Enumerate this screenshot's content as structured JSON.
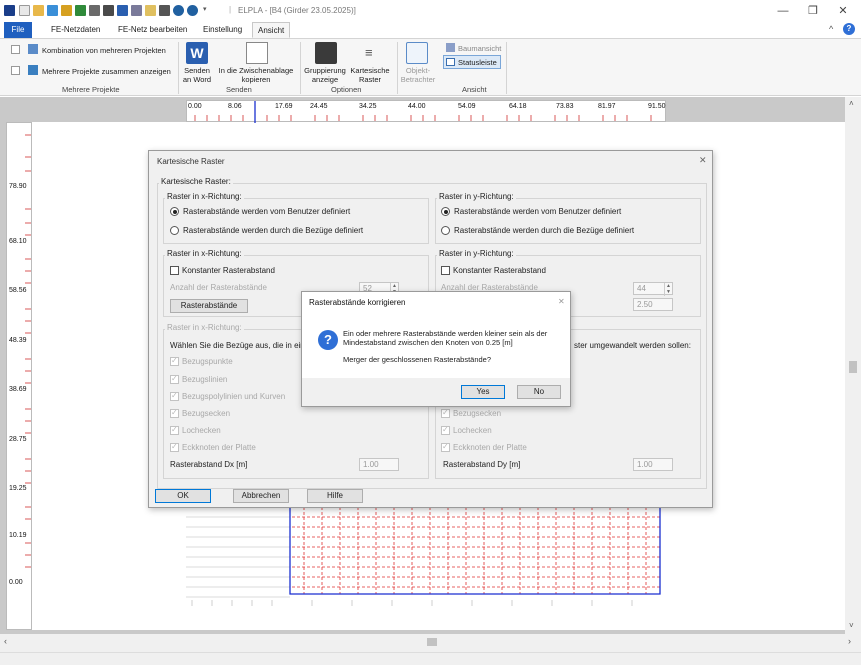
{
  "app": {
    "title": "ELPLA - [B4 (Girder 23.05.2025)]",
    "separator": "|",
    "window_controls": {
      "minimize": "—",
      "restore": "❐",
      "close": "✕"
    },
    "ribbon_collapse": "^",
    "help": "?"
  },
  "tabs": [
    {
      "label": "File"
    },
    {
      "label": "FE-Netzdaten"
    },
    {
      "label": "FE-Netz bearbeiten"
    },
    {
      "label": "Einstellung"
    },
    {
      "label": "Ansicht"
    }
  ],
  "ribbon": {
    "group_mehrere": {
      "label": "Mehrere Projekte",
      "item1": "Kombination von mehreren Projekten",
      "item2": "Mehrere Projekte zusammen anzeigen"
    },
    "group_senden": {
      "label": "Senden",
      "btn_word_l1": "Senden",
      "btn_word_l2": "an Word",
      "btn_clip_l1": "In die Zwischenablage",
      "btn_clip_l2": "kopieren"
    },
    "group_optionen": {
      "label": "Optionen",
      "btn_grup_l1": "Gruppierung",
      "btn_grup_l2": "anzeige",
      "btn_kart_l1": "Kartesische",
      "btn_kart_l2": "Raster"
    },
    "group_ansicht": {
      "label": "Ansicht",
      "btn_obj_l1": "Objekt-",
      "btn_obj_l2": "Betrachter",
      "baumansicht": "Baumansicht",
      "statusleiste": "Statusleiste"
    }
  },
  "rulers": {
    "x_labels": [
      "0.00",
      "8.06",
      "17.69",
      "24.45",
      "34.25",
      "44.00",
      "54.09",
      "64.18",
      "73.83",
      "81.97",
      "91.50"
    ],
    "y_labels": [
      "78.90",
      "68.10",
      "58.56",
      "48.39",
      "38.69",
      "28.75",
      "19.25",
      "10.19",
      "0.00"
    ]
  },
  "dialog_raster": {
    "title": "Kartesische Raster",
    "close": "✕",
    "outer_group": "Kartesische Raster:",
    "x_dir_title": "Raster in x-Richtung:",
    "y_dir_title": "Raster in y-Richtung:",
    "radio_user": "Rasterabstände werden vom Benutzer definiert",
    "radio_bezug": "Rasterabstände werden durch die Bezüge definiert",
    "x2_title": "Raster in x-Richtung:",
    "y2_title": "Raster in y-Richtung:",
    "konstant": "Konstanter Rasterabstand",
    "anzahl_label": "Anzahl der Rasterabstände",
    "anzahl_x": "52",
    "anzahl_y": "44",
    "y_value": "2.50",
    "btn_rasterabstaende": "Rasterabstände",
    "x3_title": "Raster in x-Richtung:",
    "waehlen_text": "Wählen Sie die Bezüge aus, die in ein Ra",
    "umgewandelt_text": "ster umgewandelt werden sollen:",
    "cb_bezugspunkte": "Bezugspunkte",
    "cb_bezugslinien": "Bezugslinien",
    "cb_polylinien": "Bezugspolylinien und Kurven",
    "cb_bezugsecken": "Bezugsecken",
    "cb_lochecken": "Lochecken",
    "cb_eckknoten": "Eckknoten der Platte",
    "dx_label": "Rasterabstand Dx [m]",
    "dy_label": "Rasterabstand Dy [m]",
    "dx_value": "1.00",
    "dy_value": "1.00",
    "btn_ok": "OK",
    "btn_abbrechen": "Abbrechen",
    "btn_hilfe": "Hilfe"
  },
  "dialog_confirm": {
    "title": "Rasterabstände korrigieren",
    "close": "✕",
    "icon": "?",
    "line1": "Ein oder mehrere Rasterabstände werden kleiner sein als der",
    "line2": "Mindestabstand zwischen den Knoten von 0.25 [m]",
    "question": "Merger der geschlossenen Rasterabstände?",
    "btn_yes": "Yes",
    "btn_no": "No"
  },
  "colors": {
    "file_tab": "#1f5fbf",
    "accent": "#0078d7",
    "mesh_red": "#e03030",
    "mesh_blue": "#1a2fd0",
    "question_icon": "#2f6fd6"
  }
}
